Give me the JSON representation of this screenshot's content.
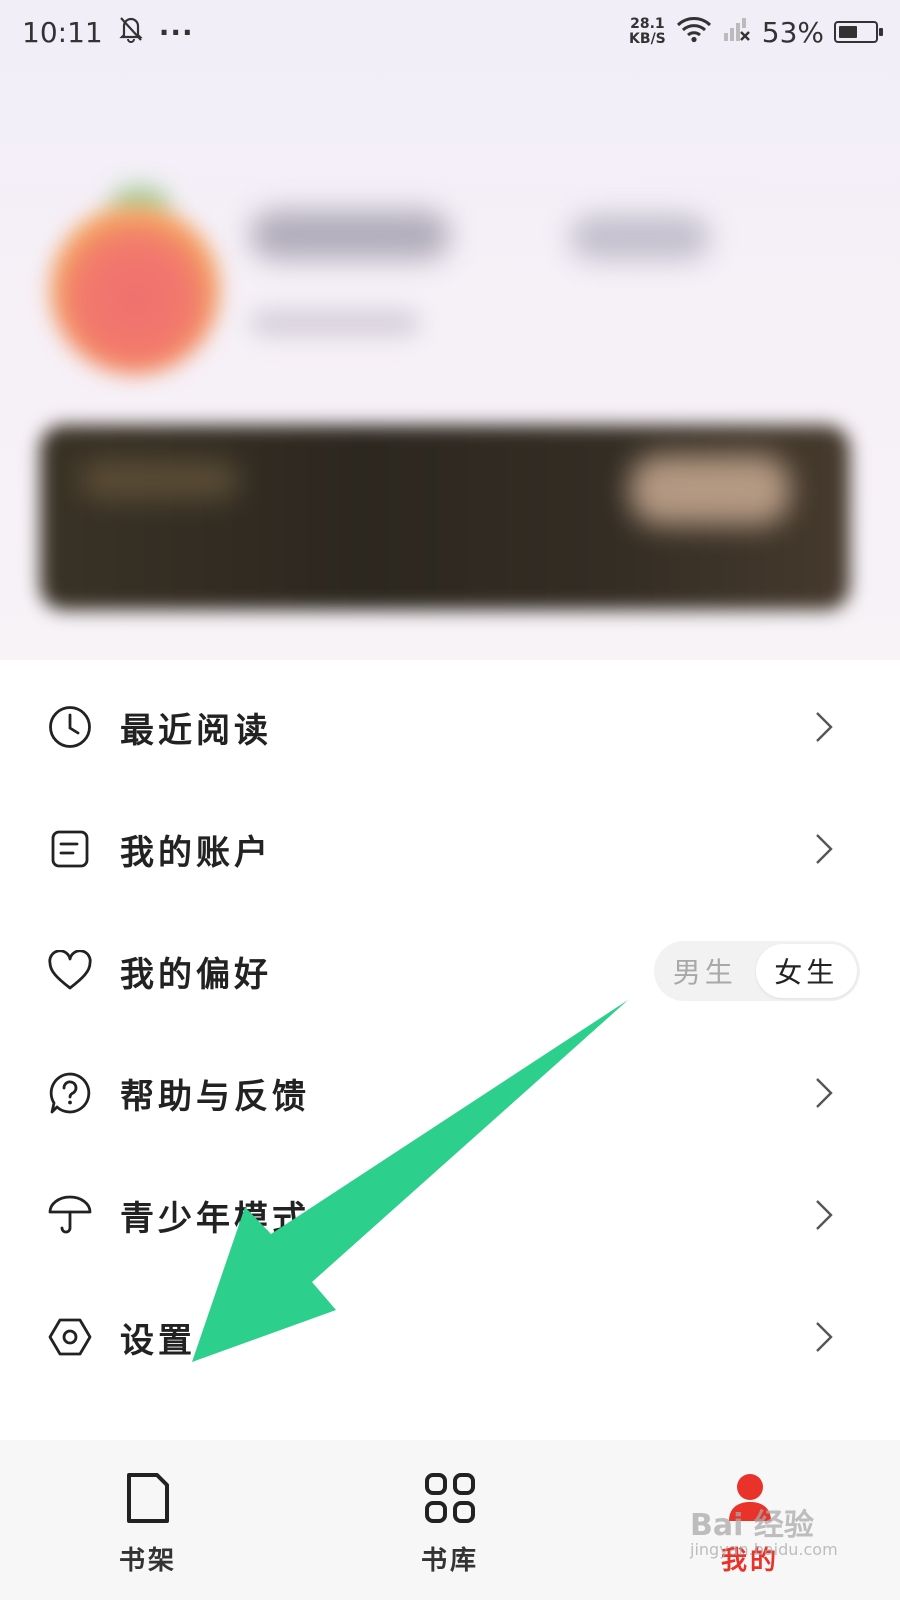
{
  "status_bar": {
    "time": "10:11",
    "more": "···",
    "net_speed_value": "28.1",
    "net_speed_unit": "KB/S",
    "battery_percent": "53%",
    "battery_level": 0.53
  },
  "menu": {
    "items": [
      {
        "label": "最近阅读",
        "icon": "clock-icon"
      },
      {
        "label": "我的账户",
        "icon": "document-icon"
      },
      {
        "label": "我的偏好",
        "icon": "heart-icon"
      },
      {
        "label": "帮助与反馈",
        "icon": "question-bubble-icon"
      },
      {
        "label": "青少年模式",
        "icon": "umbrella-icon"
      },
      {
        "label": "设置",
        "icon": "hexagon-settings-icon"
      }
    ],
    "gender_toggle": {
      "options": [
        "男生",
        "女生"
      ],
      "selected": "女生"
    }
  },
  "tabbar": {
    "tabs": [
      {
        "label": "书架",
        "icon": "bookshelf-icon"
      },
      {
        "label": "书库",
        "icon": "grid-library-icon"
      },
      {
        "label": "我的",
        "icon": "profile-icon",
        "active": true
      }
    ],
    "active_color": "#e8322a"
  },
  "annotation": {
    "arrow_color": "#2ccf8b"
  },
  "watermark": {
    "text": "Bai 经验",
    "sub": "jingyan.baidu.com"
  }
}
